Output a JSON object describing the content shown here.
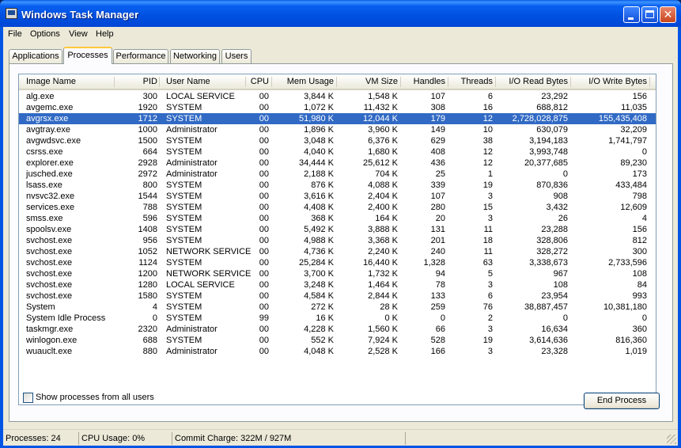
{
  "window": {
    "title": "Windows Task Manager"
  },
  "menu": [
    "File",
    "Options",
    "View",
    "Help"
  ],
  "tabs": [
    "Applications",
    "Processes",
    "Performance",
    "Networking",
    "Users"
  ],
  "active_tab": "Processes",
  "columns": [
    "Image Name",
    "PID",
    "User Name",
    "CPU",
    "Mem Usage",
    "VM Size",
    "Handles",
    "Threads",
    "I/O Read Bytes",
    "I/O Write Bytes"
  ],
  "rows": [
    [
      "alg.exe",
      "300",
      "LOCAL SERVICE",
      "00",
      "3,844 K",
      "1,548 K",
      "107",
      "6",
      "23,292",
      "156"
    ],
    [
      "avgemc.exe",
      "1920",
      "SYSTEM",
      "00",
      "1,072 K",
      "11,432 K",
      "308",
      "16",
      "688,812",
      "11,035"
    ],
    [
      "avgrsx.exe",
      "1712",
      "SYSTEM",
      "00",
      "51,980 K",
      "12,044 K",
      "179",
      "12",
      "2,728,028,875",
      "155,435,408"
    ],
    [
      "avgtray.exe",
      "1000",
      "Administrator",
      "00",
      "1,896 K",
      "3,960 K",
      "149",
      "10",
      "630,079",
      "32,209"
    ],
    [
      "avgwdsvc.exe",
      "1500",
      "SYSTEM",
      "00",
      "3,048 K",
      "6,376 K",
      "629",
      "38",
      "3,194,183",
      "1,741,797"
    ],
    [
      "csrss.exe",
      "664",
      "SYSTEM",
      "00",
      "4,040 K",
      "1,680 K",
      "408",
      "12",
      "3,993,748",
      "0"
    ],
    [
      "explorer.exe",
      "2928",
      "Administrator",
      "00",
      "34,444 K",
      "25,612 K",
      "436",
      "12",
      "20,377,685",
      "89,230"
    ],
    [
      "jusched.exe",
      "2972",
      "Administrator",
      "00",
      "2,188 K",
      "704 K",
      "25",
      "1",
      "0",
      "173"
    ],
    [
      "lsass.exe",
      "800",
      "SYSTEM",
      "00",
      "876 K",
      "4,088 K",
      "339",
      "19",
      "870,836",
      "433,484"
    ],
    [
      "nvsvc32.exe",
      "1544",
      "SYSTEM",
      "00",
      "3,616 K",
      "2,404 K",
      "107",
      "3",
      "908",
      "798"
    ],
    [
      "services.exe",
      "788",
      "SYSTEM",
      "00",
      "4,408 K",
      "2,400 K",
      "280",
      "15",
      "3,432",
      "12,609"
    ],
    [
      "smss.exe",
      "596",
      "SYSTEM",
      "00",
      "368 K",
      "164 K",
      "20",
      "3",
      "26",
      "4"
    ],
    [
      "spoolsv.exe",
      "1408",
      "SYSTEM",
      "00",
      "5,492 K",
      "3,888 K",
      "131",
      "11",
      "23,288",
      "156"
    ],
    [
      "svchost.exe",
      "956",
      "SYSTEM",
      "00",
      "4,988 K",
      "3,368 K",
      "201",
      "18",
      "328,806",
      "812"
    ],
    [
      "svchost.exe",
      "1052",
      "NETWORK SERVICE",
      "00",
      "4,736 K",
      "2,240 K",
      "240",
      "11",
      "328,272",
      "300"
    ],
    [
      "svchost.exe",
      "1124",
      "SYSTEM",
      "00",
      "25,284 K",
      "16,440 K",
      "1,328",
      "63",
      "3,338,673",
      "2,733,596"
    ],
    [
      "svchost.exe",
      "1200",
      "NETWORK SERVICE",
      "00",
      "3,700 K",
      "1,732 K",
      "94",
      "5",
      "967",
      "108"
    ],
    [
      "svchost.exe",
      "1280",
      "LOCAL SERVICE",
      "00",
      "3,248 K",
      "1,464 K",
      "78",
      "3",
      "108",
      "84"
    ],
    [
      "svchost.exe",
      "1580",
      "SYSTEM",
      "00",
      "4,584 K",
      "2,844 K",
      "133",
      "6",
      "23,954",
      "993"
    ],
    [
      "System",
      "4",
      "SYSTEM",
      "00",
      "272 K",
      "28 K",
      "259",
      "76",
      "38,887,457",
      "10,381,180"
    ],
    [
      "System Idle Process",
      "0",
      "SYSTEM",
      "99",
      "16 K",
      "0 K",
      "0",
      "2",
      "0",
      "0"
    ],
    [
      "taskmgr.exe",
      "2320",
      "Administrator",
      "00",
      "4,228 K",
      "1,560 K",
      "66",
      "3",
      "16,634",
      "360"
    ],
    [
      "winlogon.exe",
      "688",
      "SYSTEM",
      "00",
      "552 K",
      "7,924 K",
      "528",
      "19",
      "3,614,636",
      "816,360"
    ],
    [
      "wuauclt.exe",
      "880",
      "Administrator",
      "00",
      "4,048 K",
      "2,528 K",
      "166",
      "3",
      "23,328",
      "1,019"
    ]
  ],
  "selected_row": "avgrsx.exe",
  "show_all_label": "Show processes from all users",
  "end_process_label": "End Process",
  "status": {
    "processes": "Processes: 24",
    "cpu": "CPU Usage: 0%",
    "commit": "Commit Charge: 322M / 927M"
  }
}
